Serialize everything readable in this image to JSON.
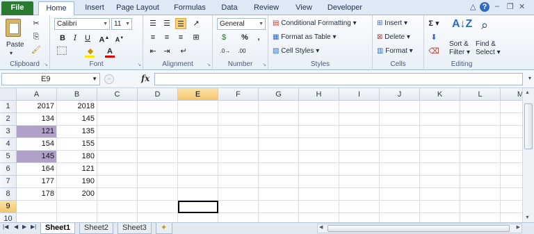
{
  "tabs": [
    "File",
    "Home",
    "Insert",
    "Page Layout",
    "Formulas",
    "Data",
    "Review",
    "View",
    "Developer"
  ],
  "ribbon": {
    "clipboard": {
      "label": "Clipboard",
      "paste": "Paste"
    },
    "font": {
      "label": "Font",
      "name": "Calibri",
      "size": "11",
      "bold": "B",
      "italic": "I",
      "underline": "U"
    },
    "alignment": {
      "label": "Alignment"
    },
    "number": {
      "label": "Number",
      "format": "General",
      "percent": "%",
      "comma": ","
    },
    "styles": {
      "label": "Styles",
      "conditional": "Conditional Formatting",
      "format_table": "Format as Table",
      "cell_styles": "Cell Styles"
    },
    "cells": {
      "label": "Cells",
      "insert": "Insert",
      "delete": "Delete",
      "format": "Format"
    },
    "editing": {
      "label": "Editing",
      "sort": "Sort &",
      "filter": "Filter",
      "find": "Find &",
      "select": "Select"
    }
  },
  "formula_bar": {
    "name_box": "E9",
    "fx": "fx",
    "formula": ""
  },
  "columns": [
    "A",
    "B",
    "C",
    "D",
    "E",
    "F",
    "G",
    "H",
    "I",
    "J",
    "K",
    "L",
    "M"
  ],
  "selected_column": "E",
  "rows": [
    "1",
    "2",
    "3",
    "4",
    "5",
    "6",
    "7",
    "8",
    "9",
    "10"
  ],
  "selected_row": "9",
  "cells": [
    [
      "2017",
      "2018"
    ],
    [
      "134",
      "145"
    ],
    [
      "121",
      "135"
    ],
    [
      "154",
      "155"
    ],
    [
      "145",
      "180"
    ],
    [
      "164",
      "121"
    ],
    [
      "177",
      "190"
    ],
    [
      "178",
      "200"
    ]
  ],
  "highlight_color": "#b1a0c7",
  "highlighted_cells": [
    "A3",
    "A5"
  ],
  "active_cell": "E9",
  "sheets": [
    "Sheet1",
    "Sheet2",
    "Sheet3"
  ],
  "active_sheet": "Sheet1"
}
